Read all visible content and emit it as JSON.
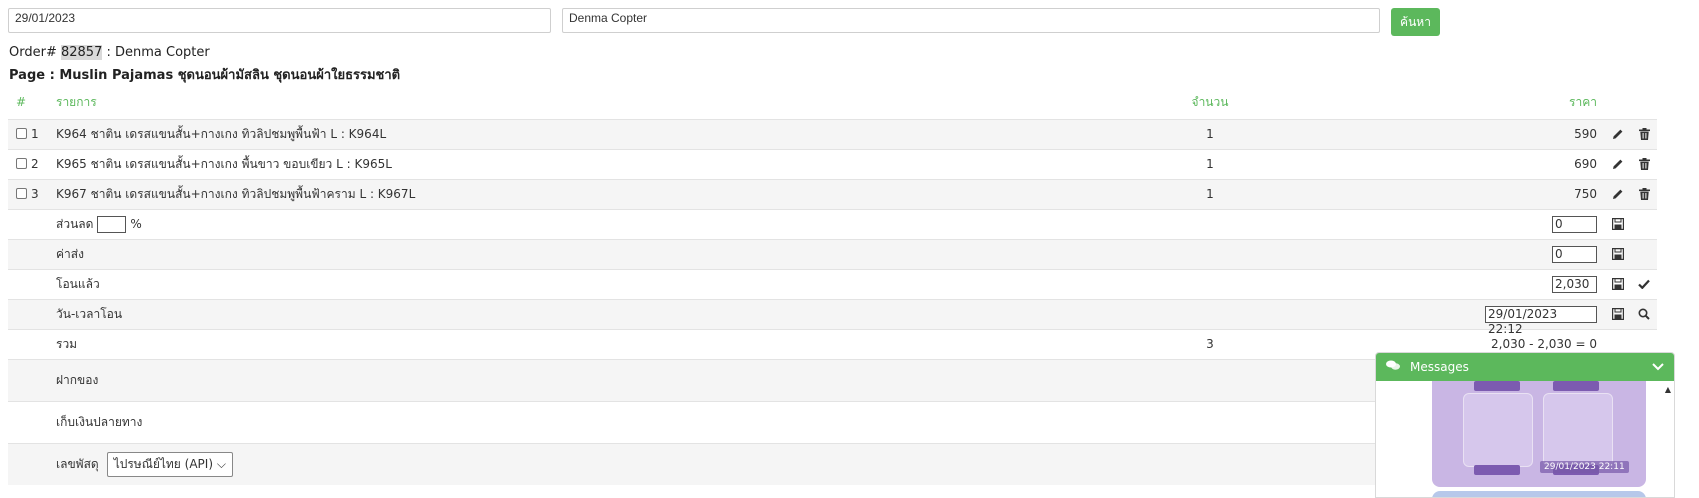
{
  "search": {
    "date_value": "29/01/2023",
    "name_value": "Denma Copter",
    "button_label": "ค้นหา"
  },
  "order": {
    "label": "Order#",
    "number": "82857",
    "customer": ": Denma Copter",
    "page_line": "Page : Muslin Pajamas ชุดนอนผ้ามัสลิน ชุดนอนผ้าใยธรรมชาติ"
  },
  "table": {
    "headers": {
      "num": "#",
      "item": "รายการ",
      "qty": "จำนวน",
      "price": "ราคา"
    },
    "rows": [
      {
        "num": "1",
        "item": "K964 ชาติน เดรสแขนสั้น+กางเกง ทิวลิปชมพูพื้นฟ้า L : K964L",
        "qty": "1",
        "price": "590"
      },
      {
        "num": "2",
        "item": "K965 ชาติน เดรสแขนสั้น+กางเกง พื้นขาว ขอบเขียว L : K965L",
        "qty": "1",
        "price": "690"
      },
      {
        "num": "3",
        "item": "K967 ชาติน เดรสแขนสั้น+กางเกง ทิวลิปชมพูพื้นฟ้าคราม L : K967L",
        "qty": "1",
        "price": "750"
      }
    ],
    "discount": {
      "label": "ส่วนลด",
      "unit": "%",
      "value": "0"
    },
    "shipping": {
      "label": "ค่าส่ง",
      "value": "0"
    },
    "transferred": {
      "label": "โอนแล้ว",
      "value": "2,030"
    },
    "transfer_time": {
      "label": "วัน-เวลาโอน",
      "value": "29/01/2023 22:12"
    },
    "total": {
      "label": "รวม",
      "qty": "3",
      "value": "2,030 - 2,030 = 0"
    },
    "deposit": {
      "label": "ฝากของ"
    },
    "cod": {
      "label": "เก็บเงินปลายทาง"
    },
    "tracking": {
      "label": "เลขพัสดุ",
      "carrier": "ไปรษณีย์ไทย (API)"
    }
  },
  "messages": {
    "title": "Messages",
    "time": "29/01/2023 22:11"
  },
  "colors": {
    "accent": "#5cb85c",
    "stripe": "#f5f5f5",
    "message_card": "#c9b6e4"
  }
}
